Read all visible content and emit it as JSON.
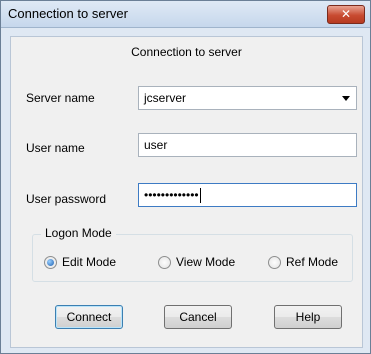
{
  "window": {
    "title": "Connection to server",
    "close_glyph": "✕"
  },
  "dialog": {
    "header": "Connection to server",
    "server_name": {
      "label": "Server name",
      "value": "jcserver"
    },
    "user_name": {
      "label": "User name",
      "value": "user"
    },
    "user_password": {
      "label": "User password",
      "masked_value": "•••••••••••••"
    },
    "logon_mode": {
      "title": "Logon Mode",
      "options": [
        {
          "label": "Edit Mode",
          "checked": true
        },
        {
          "label": "View Mode",
          "checked": false
        },
        {
          "label": "Ref Mode",
          "checked": false
        }
      ]
    },
    "buttons": {
      "connect": "Connect",
      "cancel": "Cancel",
      "help": "Help"
    }
  },
  "colors": {
    "titlebar": "#c6d7ec",
    "close_button": "#c84b31",
    "client_bg": "#f0f0f0"
  }
}
